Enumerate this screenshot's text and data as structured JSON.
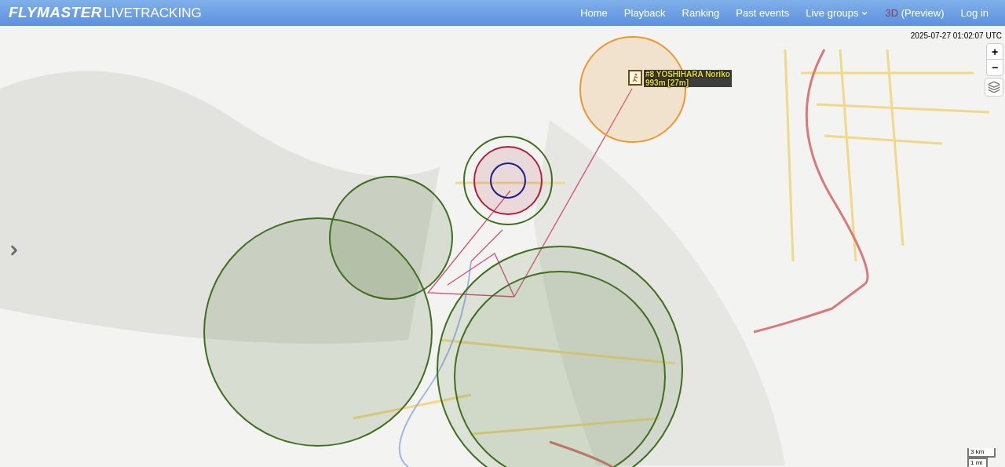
{
  "brand": {
    "name": "FLYMASTER",
    "suffix": "LIVETRACKING"
  },
  "nav": [
    {
      "label": "Home",
      "kind": "link"
    },
    {
      "label": "Playback",
      "kind": "link"
    },
    {
      "label": "Ranking",
      "kind": "link"
    },
    {
      "label": "Past events",
      "kind": "link"
    },
    {
      "label": "Live groups",
      "kind": "dropdown"
    },
    {
      "label": "(Preview)",
      "prefix": "3D",
      "kind": "link"
    },
    {
      "label": "Log in",
      "kind": "link"
    }
  ],
  "map": {
    "kind": "picture",
    "timestamp": "2025-07-27 01:02:07 UTC",
    "zoom": {
      "in": "+",
      "out": "−"
    },
    "circles": [
      {
        "color": "#e8982f"
      },
      {
        "color": "#3f6e1e"
      },
      {
        "color": "#b0203a"
      },
      {
        "color": "#1c1c8c"
      },
      {
        "color": "#3f6e1e"
      },
      {
        "color": "#3f6e1e"
      },
      {
        "color": "#3f6e1e"
      },
      {
        "color": "#3f6e1e"
      }
    ],
    "pilots": [
      {
        "name": "#8 YOSHIHARA Noriko",
        "altitude": "993m [27m]"
      }
    ],
    "scale": {
      "metric": "3 km",
      "imperial": "1 mi"
    }
  }
}
